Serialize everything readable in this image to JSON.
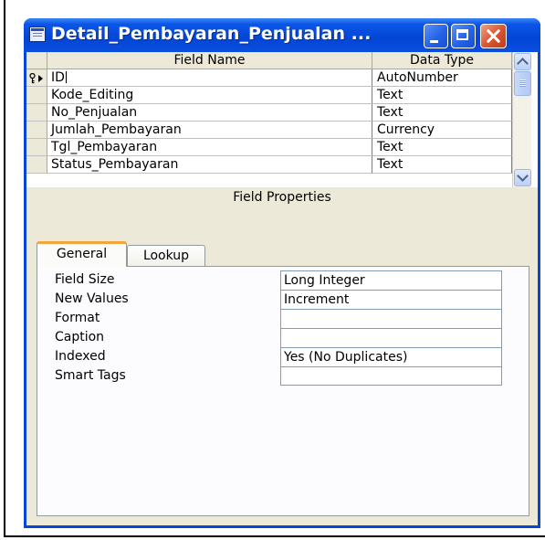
{
  "window": {
    "title": "Detail_Pembayaran_Penjualan ..."
  },
  "grid": {
    "columns": {
      "field_name": "Field Name",
      "data_type": "Data Type"
    },
    "rows": [
      {
        "field_name": "ID",
        "data_type": "AutoNumber",
        "primary_key": true,
        "current": true
      },
      {
        "field_name": "Kode_Editing",
        "data_type": "Text"
      },
      {
        "field_name": "No_Penjualan",
        "data_type": "Text"
      },
      {
        "field_name": "Jumlah_Pembayaran",
        "data_type": "Currency"
      },
      {
        "field_name": "Tgl_Pembayaran",
        "data_type": "Text"
      },
      {
        "field_name": "Status_Pembayaran",
        "data_type": "Text"
      }
    ]
  },
  "field_properties": {
    "label": "Field Properties",
    "tabs": [
      {
        "label": "General",
        "active": true
      },
      {
        "label": "Lookup",
        "active": false
      }
    ],
    "properties": [
      {
        "label": "Field Size",
        "value": "Long Integer"
      },
      {
        "label": "New Values",
        "value": "Increment"
      },
      {
        "label": "Format",
        "value": ""
      },
      {
        "label": "Caption",
        "value": ""
      },
      {
        "label": "Indexed",
        "value": "Yes (No Duplicates)"
      },
      {
        "label": "Smart Tags",
        "value": ""
      }
    ]
  },
  "colors": {
    "title_bar": "#0b55e6",
    "client_background": "#ece9d8",
    "active_tab_accent": "#f1a53a",
    "close_button": "#d95733"
  },
  "icons": {
    "title": "table-design-icon",
    "row_selector": "primary-key-icon",
    "current_row": "row-pointer-arrow-icon"
  }
}
